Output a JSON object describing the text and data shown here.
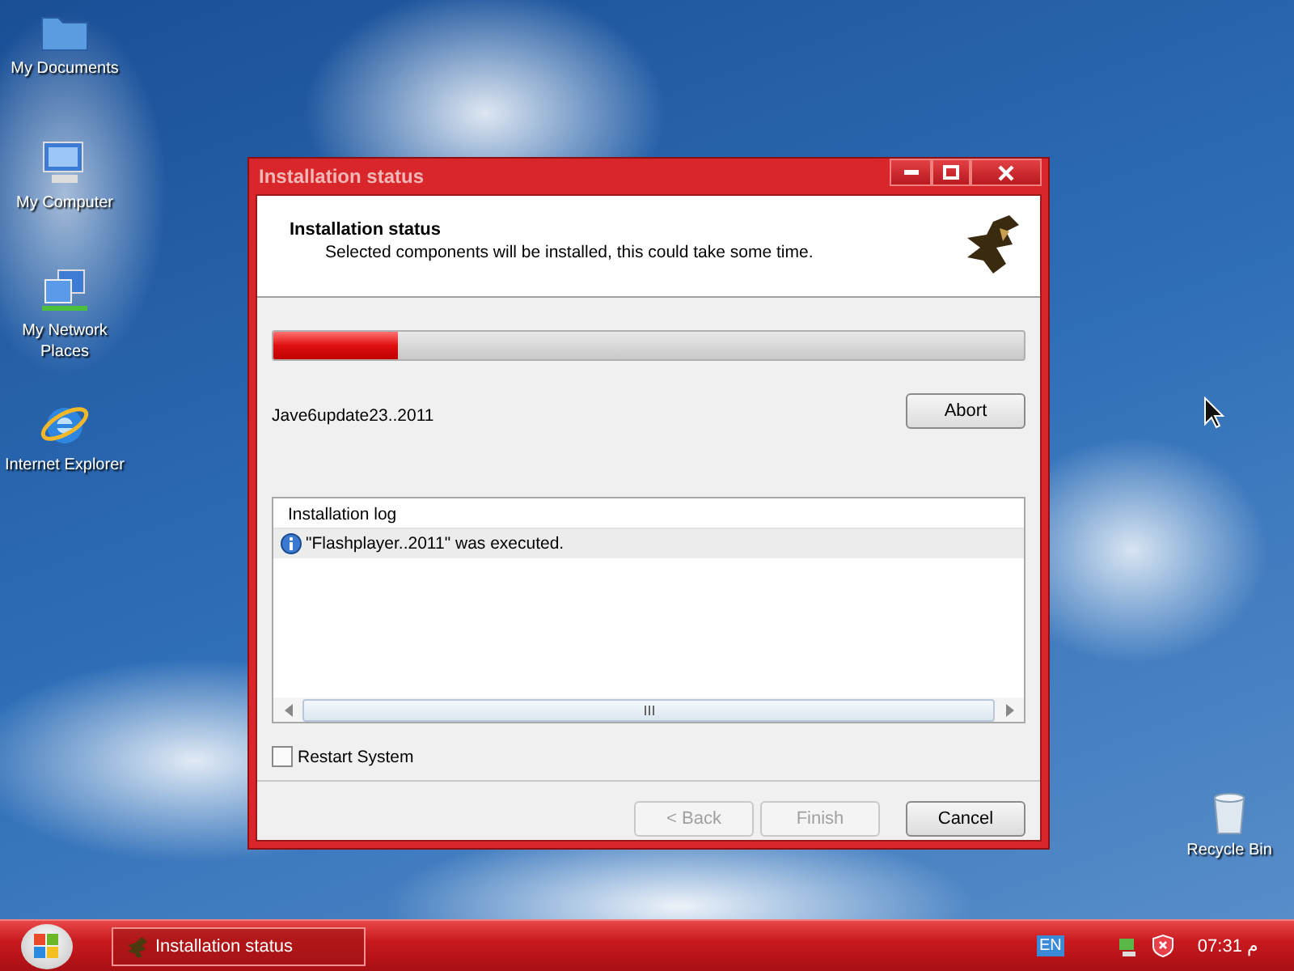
{
  "desktop_icons": [
    {
      "label": "My Documents",
      "kind": "documents"
    },
    {
      "label": "My Computer",
      "kind": "computer"
    },
    {
      "label": "My Network Places",
      "kind": "network"
    },
    {
      "label": "Internet Explorer",
      "kind": "browser"
    },
    {
      "label": "Recycle Bin",
      "kind": "recycle"
    }
  ],
  "window": {
    "title": "Installation status",
    "header": {
      "title": "Installation status",
      "subtitle": "Selected components will be installed, this could take some time."
    },
    "progress": {
      "level": 0.165
    },
    "current_item": "Jave6update23..2011",
    "abort_button": "Abort",
    "log": {
      "title": "Installation log",
      "entries": [
        {
          "text": "\"Flashplayer..2011\" was executed.",
          "selected": true
        }
      ]
    },
    "restart_checkbox": {
      "label": "Restart System",
      "checked": false
    },
    "buttons": [
      {
        "label": "< Back",
        "disabled": true
      },
      {
        "label": "Finish",
        "disabled": true
      },
      {
        "label": "Cancel",
        "disabled": false
      }
    ]
  },
  "taskbar": {
    "tasks": [
      {
        "label": "Installation status"
      }
    ],
    "language": "EN",
    "clock": "07:31 م"
  }
}
